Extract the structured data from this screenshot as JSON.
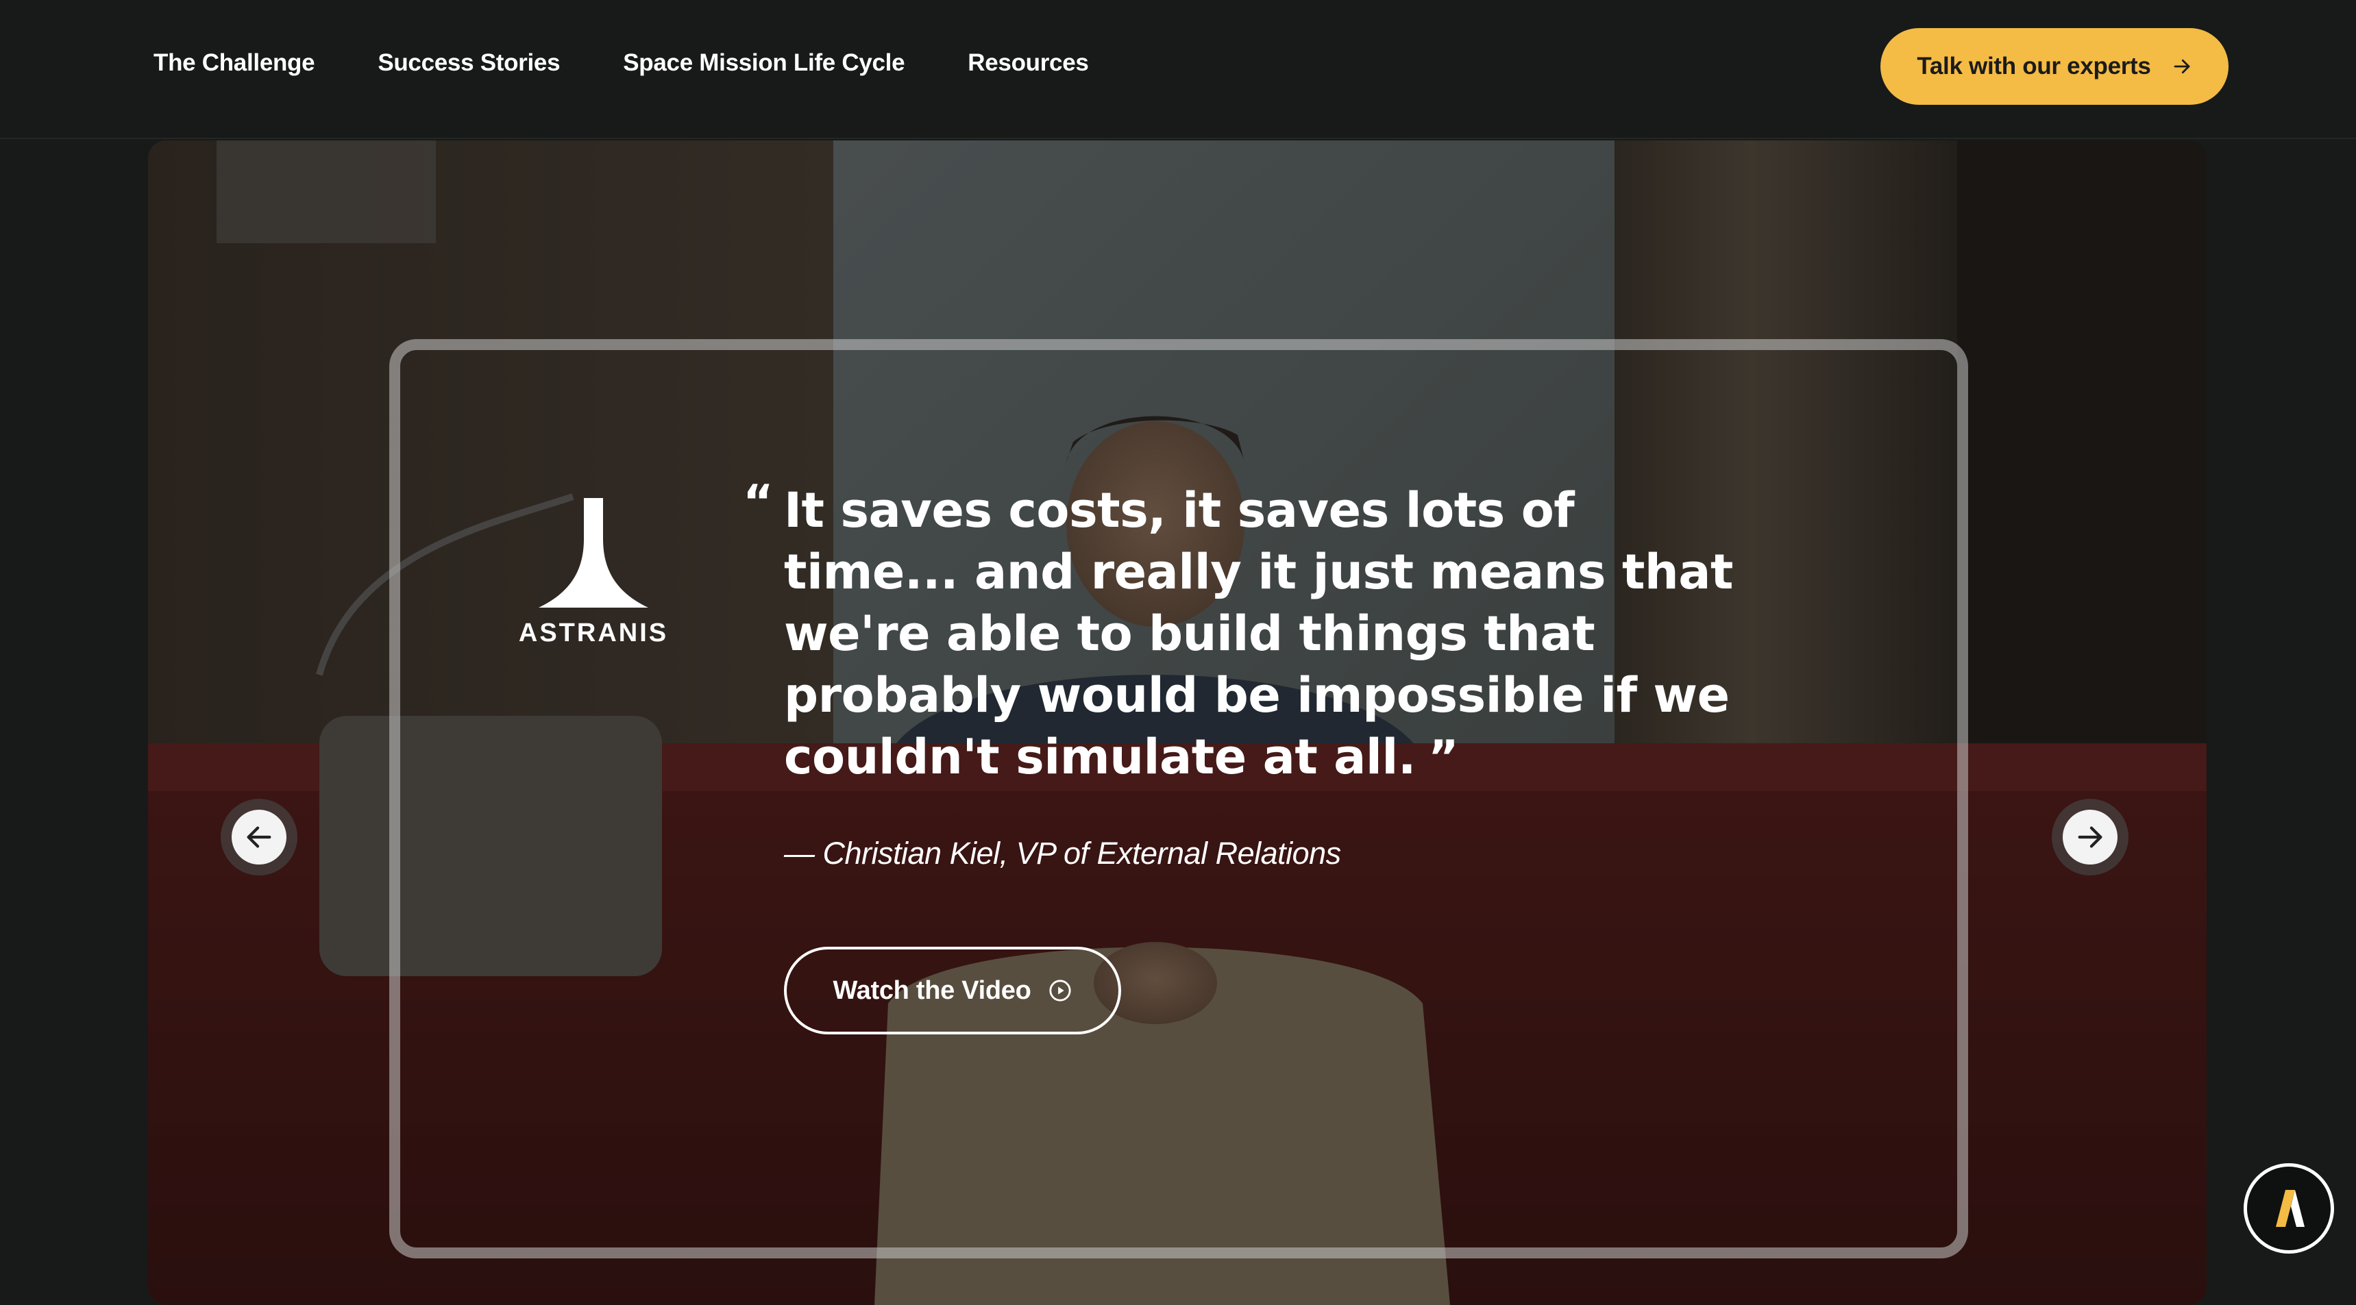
{
  "header": {
    "nav": [
      {
        "label": "The Challenge"
      },
      {
        "label": "Success Stories"
      },
      {
        "label": "Space Mission Life Cycle"
      },
      {
        "label": "Resources"
      }
    ],
    "cta_label": "Talk with our experts",
    "cta_color": "#f4bb45"
  },
  "testimonial": {
    "company_logo_text": "ASTRANIS",
    "quote_open": "“",
    "quote": "It saves costs, it saves lots of time... and really it just means that we're able to build things that probably would be impossible if we couldn't simulate at all.",
    "quote_close": "”",
    "attribution": "— Christian Kiel, VP of External Relations",
    "watch_label": "Watch the Video"
  },
  "controls": {
    "prev_icon": "arrow-left-icon",
    "next_icon": "arrow-right-icon",
    "fab_icon": "brand-a-icon"
  }
}
